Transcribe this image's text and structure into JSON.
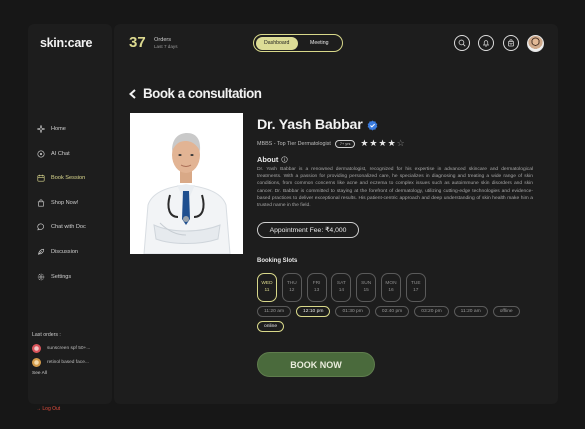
{
  "brand": {
    "logo": "skin:care"
  },
  "sidebar": {
    "items": [
      {
        "label": "Home",
        "icon": "sparkle-icon"
      },
      {
        "label": "AI Chat",
        "icon": "ai-chat-icon"
      },
      {
        "label": "Book Session",
        "icon": "calendar-icon",
        "active": true
      },
      {
        "label": "Shop Now!",
        "icon": "shop-icon"
      },
      {
        "label": "Chat with Doc",
        "icon": "chat-icon"
      },
      {
        "label": "Discussion",
        "icon": "feather-icon"
      },
      {
        "label": "Settings",
        "icon": "gear-icon"
      }
    ],
    "last_orders": {
      "title": "Last orders :",
      "items": [
        "sunscreen spf 50+...",
        "retinol based face..."
      ],
      "see_all": "See All"
    },
    "logout": "→ Log Out"
  },
  "header": {
    "orders_count": "37",
    "orders_label": "Orders",
    "orders_sub": "Last 7 days",
    "segments": [
      "Dashboard",
      "Meeting"
    ],
    "active_segment": "Dashboard",
    "icons": [
      "search-icon",
      "bell-icon",
      "bag-icon"
    ]
  },
  "page": {
    "title": "Book a consultation"
  },
  "doctor": {
    "name": "Dr. Yash Babbar",
    "qualification": "MBBS - Top Tier Dermatologist",
    "experience": "7+ yrs",
    "rating": 4,
    "rating_max": 5,
    "stars_on": "★★★★",
    "stars_off": "☆",
    "about_title": "About",
    "about_text": "Dr. Yash Babbar is a renowned dermatologist, recognized for his expertise in advanced skincare and dermatological treatments. With a passion for providing personalized care, he specializes in diagnosing and treating a wide range of skin conditions, from common concerns like acne and eczema to complex issues such as autoimmune skin disorders and skin cancer. Dr. Babbar is committed to staying at the forefront of dermatology, utilizing cutting-edge technologies and evidence-based practices to deliver exceptional results. His patient-centric approach and deep understanding of skin health make him a trusted name in the field.",
    "fee": "Appointment Fee: ₹4,000"
  },
  "booking": {
    "title": "Booking Slots",
    "days": [
      {
        "day": "WED",
        "date": "11",
        "active": true
      },
      {
        "day": "THU",
        "date": "12"
      },
      {
        "day": "FRI",
        "date": "13"
      },
      {
        "day": "SAT",
        "date": "14"
      },
      {
        "day": "SUN",
        "date": "15"
      },
      {
        "day": "MON",
        "date": "16"
      },
      {
        "day": "TUE",
        "date": "17"
      }
    ],
    "times": [
      {
        "label": "11:20 am"
      },
      {
        "label": "12:10 pm",
        "active": true
      },
      {
        "label": "01:30 pm"
      },
      {
        "label": "02:40 pm"
      },
      {
        "label": "03:20 pm"
      },
      {
        "label": "11:20 am"
      },
      {
        "label": "offline"
      },
      {
        "label": "online",
        "active": true
      }
    ],
    "cta": "BOOK NOW"
  },
  "colors": {
    "accent": "#dcd98f",
    "cta": "#4a6a3c",
    "bg": "#171717",
    "panel": "#1d1d1d",
    "verified": "#3b7de0",
    "logout": "#e04c3c"
  }
}
